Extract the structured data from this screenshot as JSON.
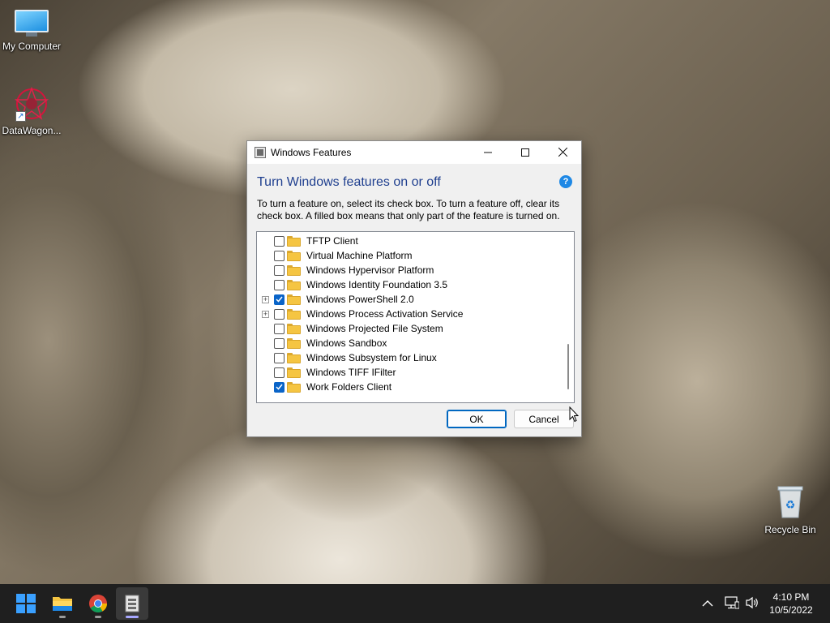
{
  "desktop": {
    "icons": [
      {
        "label": "My Computer"
      },
      {
        "label": "DataWagon..."
      },
      {
        "label": "Recycle Bin"
      }
    ]
  },
  "window": {
    "title": "Windows Features",
    "controls": {
      "minimize": "—",
      "maximize": "☐",
      "close": "✕"
    },
    "heading": "Turn Windows features on or off",
    "help": "?",
    "description": "To turn a feature on, select its check box. To turn a feature off, clear its check box. A filled box means that only part of the feature is turned on.",
    "features": [
      {
        "label": "TFTP Client",
        "checked": false,
        "expandable": false
      },
      {
        "label": "Virtual Machine Platform",
        "checked": false,
        "expandable": false
      },
      {
        "label": "Windows Hypervisor Platform",
        "checked": false,
        "expandable": false
      },
      {
        "label": "Windows Identity Foundation 3.5",
        "checked": false,
        "expandable": false
      },
      {
        "label": "Windows PowerShell 2.0",
        "checked": true,
        "expandable": true
      },
      {
        "label": "Windows Process Activation Service",
        "checked": false,
        "expandable": true
      },
      {
        "label": "Windows Projected File System",
        "checked": false,
        "expandable": false
      },
      {
        "label": "Windows Sandbox",
        "checked": false,
        "expandable": false
      },
      {
        "label": "Windows Subsystem for Linux",
        "checked": false,
        "expandable": false
      },
      {
        "label": "Windows TIFF IFilter",
        "checked": false,
        "expandable": false
      },
      {
        "label": "Work Folders Client",
        "checked": true,
        "expandable": false
      }
    ],
    "ok_label": "OK",
    "cancel_label": "Cancel"
  },
  "taskbar": {
    "clock_time": "4:10 PM",
    "clock_date": "10/5/2022"
  },
  "colors": {
    "accent": "#0067c0",
    "heading": "#1f3f8f",
    "taskbar": "#1f1f1f"
  }
}
